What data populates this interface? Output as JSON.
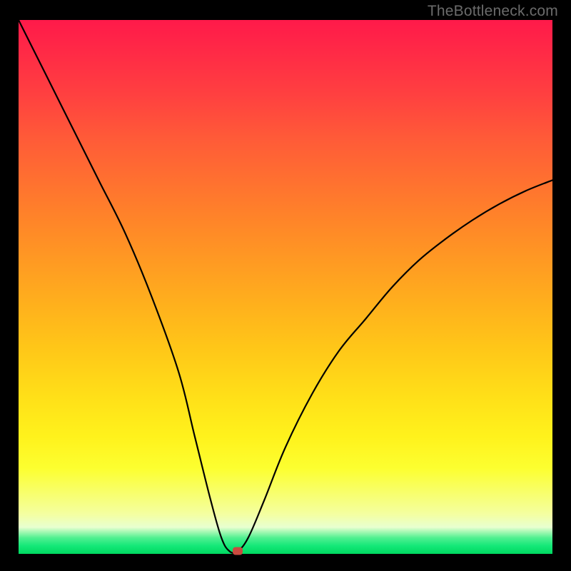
{
  "watermark": "TheBottleneck.com",
  "chart_data": {
    "type": "line",
    "title": "",
    "xlabel": "",
    "ylabel": "",
    "xlim": [
      0,
      100
    ],
    "ylim": [
      0,
      100
    ],
    "series": [
      {
        "name": "curve",
        "x": [
          0,
          5,
          10,
          15,
          20,
          25,
          30,
          33,
          36,
          38,
          39.5,
          41,
          43,
          46,
          50,
          55,
          60,
          65,
          70,
          75,
          80,
          85,
          90,
          95,
          100
        ],
        "values": [
          100,
          90,
          80,
          70,
          60,
          48,
          34,
          22,
          10,
          3,
          0.5,
          0.5,
          3,
          10,
          20,
          30,
          38,
          44,
          50,
          55,
          59,
          62.5,
          65.5,
          68,
          70
        ]
      }
    ],
    "marker": {
      "x": 41,
      "y": 0.5
    },
    "background": "red-yellow-green-vertical-gradient"
  }
}
